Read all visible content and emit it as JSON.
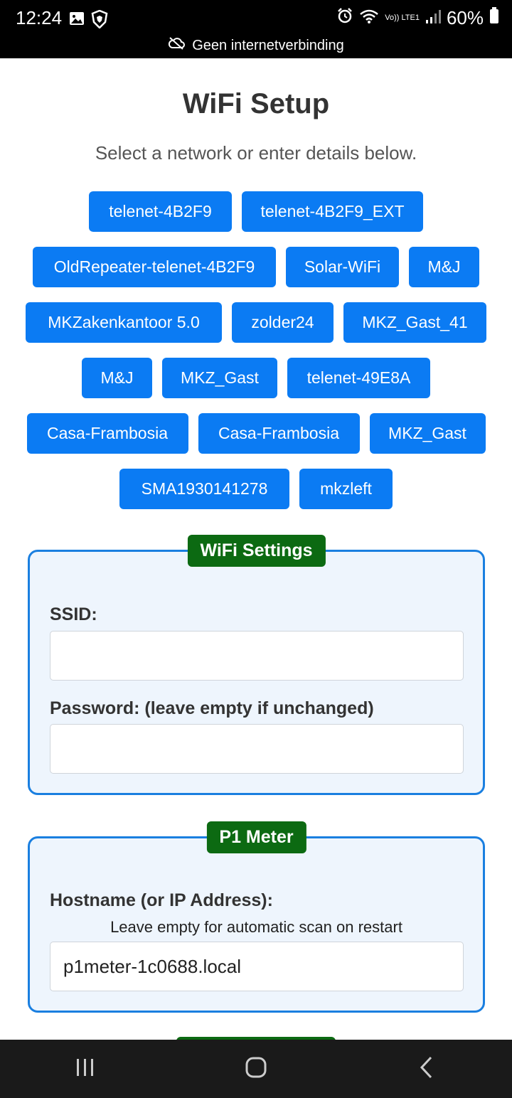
{
  "status_bar": {
    "time": "12:24",
    "battery": "60%",
    "network_label": "Vo)) LTE1",
    "no_internet_message": "Geen internetverbinding"
  },
  "page": {
    "title": "WiFi Setup",
    "subtitle": "Select a network or enter details below."
  },
  "networks": [
    [
      "telenet-4B2F9",
      "telenet-4B2F9_EXT"
    ],
    [
      "OldRepeater-telenet-4B2F9",
      "Solar-WiFi",
      "M&J"
    ],
    [
      "MKZakenkantoor 5.0",
      "zolder24",
      "MKZ_Gast_41"
    ],
    [
      "M&J",
      "MKZ_Gast",
      "telenet-49E8A"
    ],
    [
      "Casa-Frambosia",
      "Casa-Frambosia",
      "MKZ_Gast"
    ],
    [
      "SMA1930141278",
      "mkzleft"
    ]
  ],
  "wifi_settings": {
    "legend": "WiFi Settings",
    "ssid_label": "SSID:",
    "ssid_value": "",
    "password_label": "Password: (leave empty if unchanged)",
    "password_value": ""
  },
  "p1_meter": {
    "legend": "P1 Meter",
    "hostname_label": "Hostname (or IP Address):",
    "hostname_hint": "Leave empty for automatic scan on restart",
    "hostname_value": "p1meter-1c0688.local"
  },
  "colors": {
    "network_button": "#0b7bf3",
    "legend_bg": "#0c6a12",
    "fieldset_border": "#1a7fe0",
    "fieldset_bg": "#eef5fd"
  },
  "icons": {
    "status_left": [
      "image-icon",
      "shield-lion-icon"
    ],
    "status_right": [
      "alarm-icon",
      "wifi-icon",
      "signal-icon",
      "battery-icon"
    ],
    "nav": [
      "recent-apps-icon",
      "home-icon",
      "back-icon"
    ]
  }
}
